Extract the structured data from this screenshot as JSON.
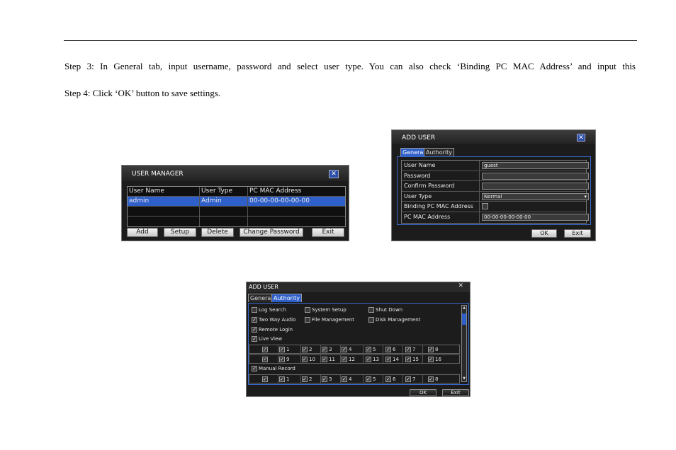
{
  "doc": {
    "step3": "Step 3: In General tab, input username, password and select user type. You can also check ‘Binding PC MAC Address’ and input this",
    "step4": "Step 4: Click ‘OK’ button to save settings."
  },
  "user_manager": {
    "title": "USER MANAGER",
    "columns": [
      "User Name",
      "User Type",
      "PC MAC Address"
    ],
    "rows": [
      {
        "name": "admin",
        "type": "Admin",
        "mac": "00-00-00-00-00-00"
      }
    ],
    "buttons": {
      "add": "Add",
      "setup": "Setup",
      "delete": "Delete",
      "change_password": "Change Password",
      "exit": "Exit"
    },
    "close": "✕"
  },
  "add_user_general": {
    "title": "ADD USER",
    "tabs": {
      "general": "General",
      "authority": "Authority"
    },
    "fields": {
      "user_name_label": "User Name",
      "user_name_value": "guest",
      "password_label": "Password",
      "confirm_label": "Confirm Password",
      "user_type_label": "User Type",
      "user_type_value": "Normal",
      "binding_label": "Binding PC MAC Address",
      "mac_label": "PC MAC Address",
      "mac_value": "00-00-00-00-00-00"
    },
    "buttons": {
      "ok": "OK",
      "exit": "Exit"
    },
    "close": "✕"
  },
  "add_user_authority": {
    "title": "ADD USER",
    "close": "✕",
    "tabs": {
      "general": "General",
      "authority": "Authority"
    },
    "items": {
      "log_search": "Log Search",
      "system_setup": "System Setup",
      "shut_down": "Shut Down",
      "two_way_audio": "Two Way Audio",
      "file_management": "File Management",
      "disk_management": "Disk Management",
      "remote_login": "Remote Login",
      "live_view": "Live View",
      "manual_record": "Manual Record"
    },
    "channels_row1": [
      "1",
      "2",
      "3",
      "4",
      "5",
      "6",
      "7",
      "8"
    ],
    "channels_row2": [
      "9",
      "10",
      "11",
      "12",
      "13",
      "14",
      "15",
      "16"
    ],
    "checkmark": "✓",
    "buttons": {
      "ok": "OK",
      "exit": "Exit"
    }
  }
}
